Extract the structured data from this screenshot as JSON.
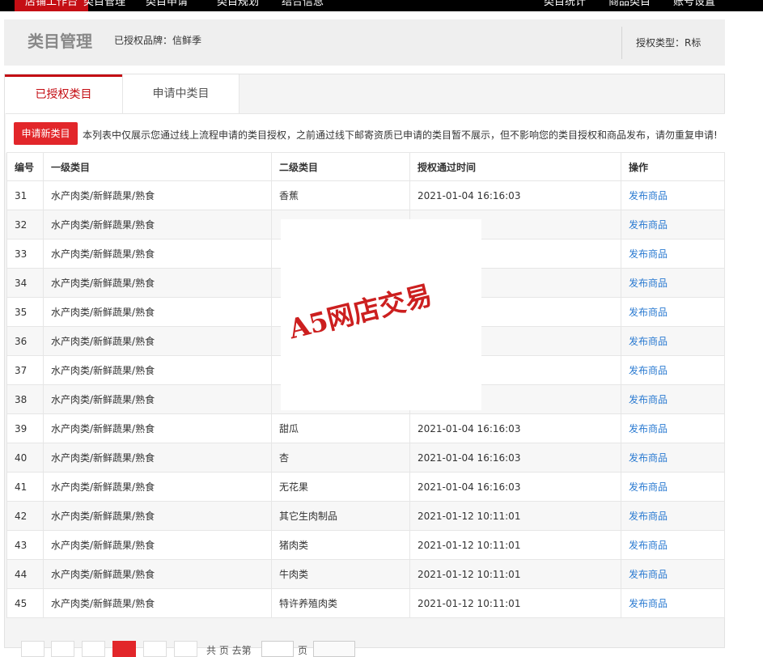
{
  "nav": {
    "active": "店铺工作台",
    "items": [
      "类目管理",
      "类目申请",
      "类目规划",
      "结合信息"
    ],
    "right_items": [
      "类目统计",
      "商品类目",
      "账号设置"
    ]
  },
  "header": {
    "title": "类目管理",
    "brand": "已授权品牌：信鲜季",
    "auth_type": "授权类型：R标"
  },
  "tabs": {
    "authorized": "已授权类目",
    "applying": "申请中类目"
  },
  "notice": {
    "button": "申请新类目",
    "text": "本列表中仅展示您通过线上流程申请的类目授权，之前通过线下邮寄资质已申请的类目暂不展示，但不影响您的类目授权和商品发布，请勿重复申请!"
  },
  "table": {
    "headers": [
      "编号",
      "一级类目",
      "二级类目",
      "授权通过时间",
      "操作"
    ],
    "rows": [
      {
        "id": "31",
        "l1": "水产肉类/新鲜蔬果/熟食",
        "l2": "香蕉",
        "time": "2021-01-04 16:16:03",
        "op": "发布商品"
      },
      {
        "id": "32",
        "l1": "水产肉类/新鲜蔬果/熟食",
        "l2": "",
        "time": "",
        "op": "发布商品"
      },
      {
        "id": "33",
        "l1": "水产肉类/新鲜蔬果/熟食",
        "l2": "",
        "time": "",
        "op": "发布商品"
      },
      {
        "id": "34",
        "l1": "水产肉类/新鲜蔬果/熟食",
        "l2": "",
        "time": "",
        "op": "发布商品"
      },
      {
        "id": "35",
        "l1": "水产肉类/新鲜蔬果/熟食",
        "l2": "",
        "time": "",
        "op": "发布商品"
      },
      {
        "id": "36",
        "l1": "水产肉类/新鲜蔬果/熟食",
        "l2": "",
        "time": "",
        "op": "发布商品"
      },
      {
        "id": "37",
        "l1": "水产肉类/新鲜蔬果/熟食",
        "l2": "",
        "time": "",
        "op": "发布商品"
      },
      {
        "id": "38",
        "l1": "水产肉类/新鲜蔬果/熟食",
        "l2": "",
        "time": "",
        "op": "发布商品"
      },
      {
        "id": "39",
        "l1": "水产肉类/新鲜蔬果/熟食",
        "l2": "甜瓜",
        "time": "2021-01-04 16:16:03",
        "op": "发布商品"
      },
      {
        "id": "40",
        "l1": "水产肉类/新鲜蔬果/熟食",
        "l2": "杏",
        "time": "2021-01-04 16:16:03",
        "op": "发布商品"
      },
      {
        "id": "41",
        "l1": "水产肉类/新鲜蔬果/熟食",
        "l2": "无花果",
        "time": "2021-01-04 16:16:03",
        "op": "发布商品"
      },
      {
        "id": "42",
        "l1": "水产肉类/新鲜蔬果/熟食",
        "l2": "其它生肉制品",
        "time": "2021-01-12 10:11:01",
        "op": "发布商品"
      },
      {
        "id": "43",
        "l1": "水产肉类/新鲜蔬果/熟食",
        "l2": "猪肉类",
        "time": "2021-01-12 10:11:01",
        "op": "发布商品"
      },
      {
        "id": "44",
        "l1": "水产肉类/新鲜蔬果/熟食",
        "l2": "牛肉类",
        "time": "2021-01-12 10:11:01",
        "op": "发布商品"
      },
      {
        "id": "45",
        "l1": "水产肉类/新鲜蔬果/熟食",
        "l2": "特许养殖肉类",
        "time": "2021-01-12 10:11:01",
        "op": "发布商品"
      }
    ]
  },
  "pager": {
    "text_total": "共 页 去第",
    "text_page": "页"
  },
  "watermark": {
    "text": "A5网店交易"
  },
  "colors": {
    "accent": "#c40e14",
    "button": "#e2262a",
    "link": "#2a7ad1"
  }
}
